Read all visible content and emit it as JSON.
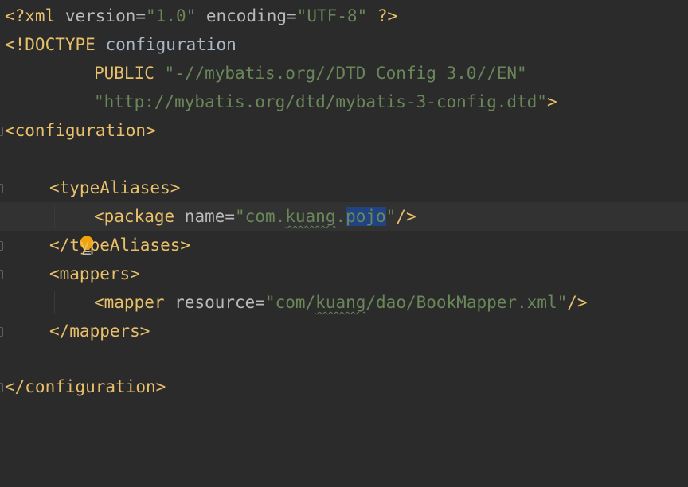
{
  "editor": {
    "language": "xml",
    "intention_icon": "lightbulb-icon",
    "colors": {
      "background": "#2b2b2b",
      "current_line": "#323232",
      "tag": "#e8bf6a",
      "attribute": "#bababa",
      "string": "#6a8759",
      "text": "#a9b7c6",
      "selection": "#214283",
      "bulb": "#f0a30a"
    },
    "lines": {
      "l1": {
        "open": "<?xml ",
        "attr1": "version=",
        "val1": "\"1.0\"",
        "attr2": " encoding=",
        "val2": "\"UTF-8\"",
        "close": " ?>"
      },
      "l2": {
        "open": "<!DOCTYPE ",
        "name": "configuration"
      },
      "l3": {
        "keyword": "PUBLIC ",
        "val": "\"-//mybatis.org//DTD Config 3.0//EN\""
      },
      "l4": {
        "val": "\"http://mybatis.org/dtd/mybatis-3-config.dtd\"",
        "close": ">"
      },
      "l5": {
        "tag": "<configuration>"
      },
      "l7": {
        "tag": "<typeAliases>"
      },
      "l8": {
        "open": "<package ",
        "attr": "name=",
        "quote_open": "\"",
        "v1": "com.",
        "v2": "kuang",
        "v3": ".",
        "v4": "pojo",
        "quote_close": "\"",
        "close": "/>"
      },
      "l9": {
        "tag": "</typeAliases>"
      },
      "l10": {
        "tag": "<mappers>"
      },
      "l11": {
        "open": "<mapper ",
        "attr": "resource=",
        "v1": "\"com/",
        "v2": "kuang",
        "v3": "/dao/BookMapper.xml\"",
        "close": "/>"
      },
      "l12": {
        "tag": "</mappers>"
      },
      "l14": {
        "tag": "</configuration>"
      }
    }
  }
}
